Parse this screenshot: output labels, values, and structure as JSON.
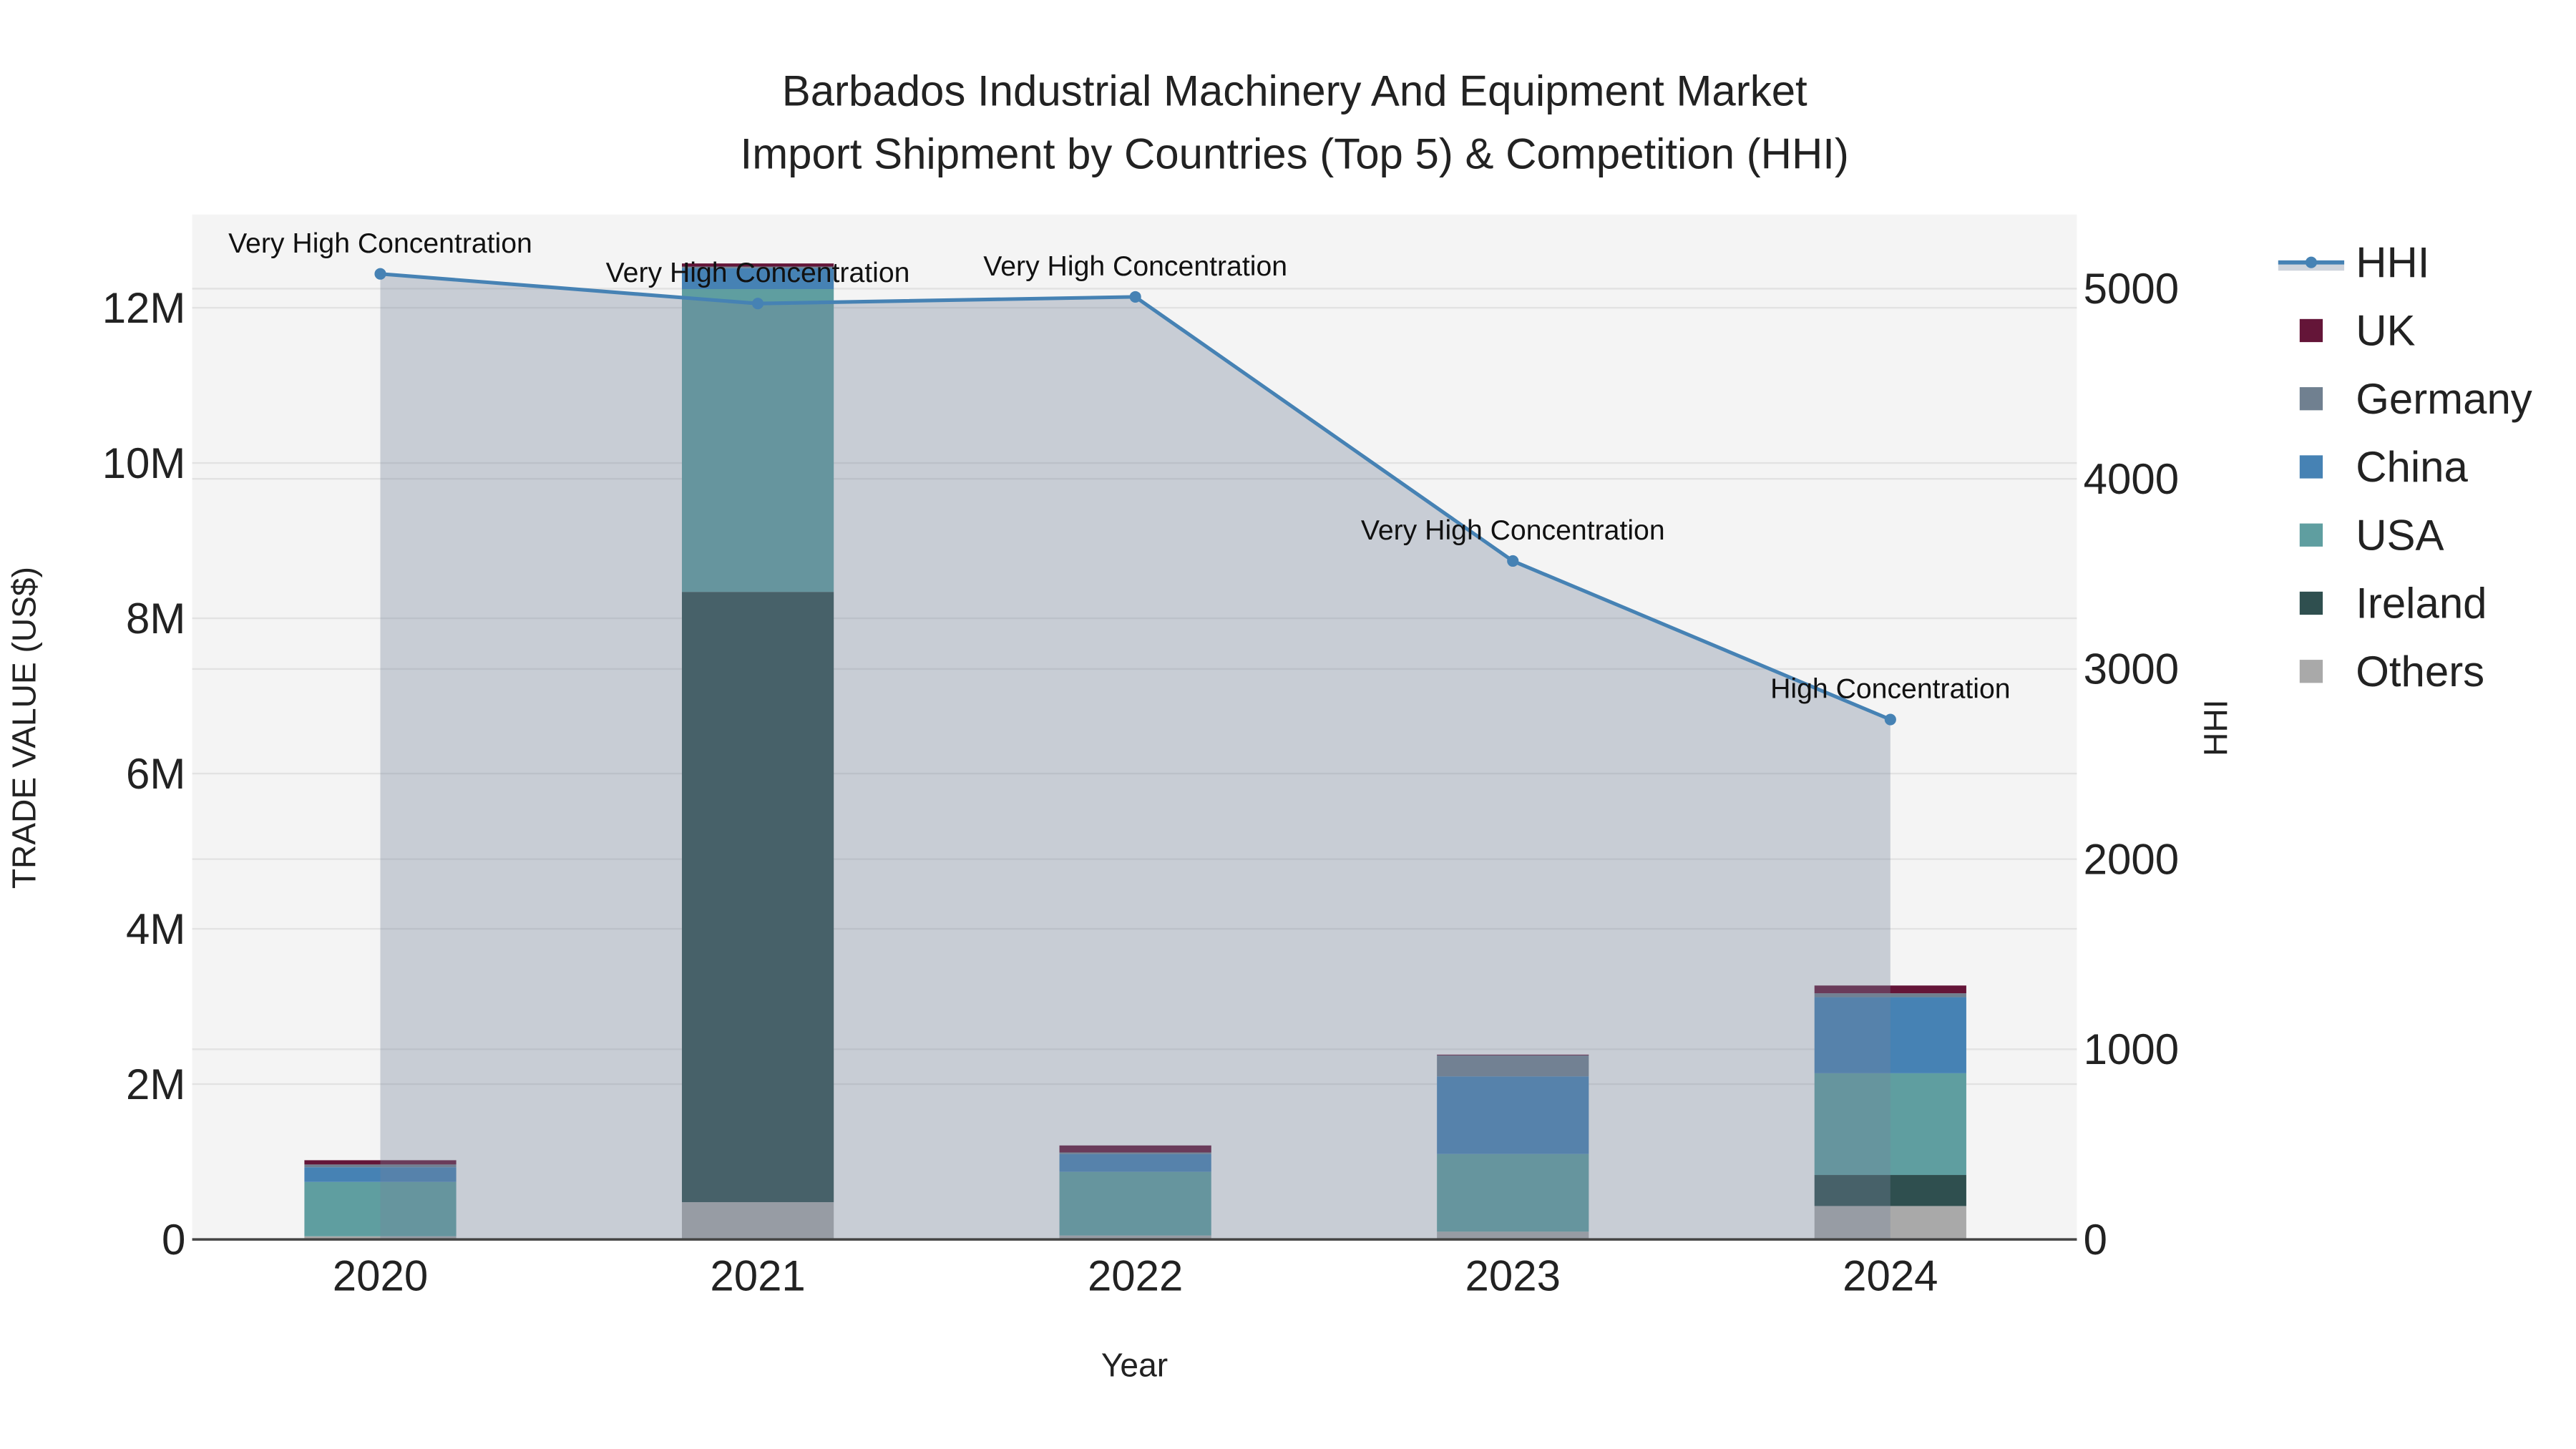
{
  "chart_data": {
    "type": "bar",
    "title_line1": "Barbados Industrial Machinery And Equipment Market",
    "title_line2": "Import Shipment by Countries (Top 5) & Competition (HHI)",
    "xlabel": "Year",
    "ylabel": "TRADE VALUE (US$)",
    "y2label": "HHI",
    "categories": [
      "2020",
      "2021",
      "2022",
      "2023",
      "2024"
    ],
    "ylim": [
      0,
      13200000
    ],
    "y2lim": [
      0,
      5390
    ],
    "yticks": [
      0,
      2000000,
      4000000,
      6000000,
      8000000,
      10000000,
      12000000
    ],
    "ytick_labels": [
      "0",
      "2M",
      "4M",
      "6M",
      "8M",
      "10M",
      "12M"
    ],
    "y2ticks": [
      0,
      1000,
      2000,
      3000,
      4000,
      5000
    ],
    "y2tick_labels": [
      "0",
      "1000",
      "2000",
      "3000",
      "4000",
      "5000"
    ],
    "grid": true,
    "legend_placement": "right",
    "series": [
      {
        "name": "Others",
        "color": "#a9a9a9",
        "values": [
          40000,
          480000,
          50000,
          100000,
          430000
        ]
      },
      {
        "name": "Ireland",
        "color": "#2f4f4f",
        "values": [
          0,
          7860000,
          0,
          0,
          400000
        ]
      },
      {
        "name": "USA",
        "color": "#5f9ea0",
        "values": [
          700000,
          3900000,
          820000,
          1000000,
          1310000
        ]
      },
      {
        "name": "China",
        "color": "#4682b4",
        "values": [
          190000,
          270000,
          230000,
          1000000,
          980000
        ]
      },
      {
        "name": "Germany",
        "color": "#708090",
        "values": [
          35000,
          20000,
          20000,
          270000,
          50000
        ]
      },
      {
        "name": "UK",
        "color": "#641538",
        "values": [
          55000,
          40000,
          90000,
          10000,
          100000
        ]
      }
    ],
    "hhi": {
      "name": "HHI",
      "color": "#4682b4",
      "values": [
        5078,
        4922,
        4957,
        3568,
        2734
      ],
      "annotations": [
        "Very High Concentration",
        "Very High Concentration",
        "Very High Concentration",
        "Very High Concentration",
        "High Concentration"
      ]
    },
    "legend": [
      "HHI",
      "UK",
      "Germany",
      "China",
      "USA",
      "Ireland",
      "Others"
    ]
  }
}
